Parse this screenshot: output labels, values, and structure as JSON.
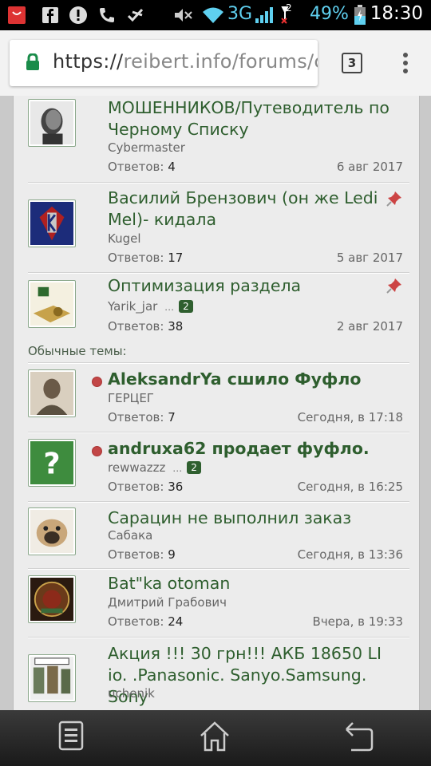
{
  "status_bar": {
    "network": "3G",
    "signal_extra": "2",
    "battery": "49%",
    "time": "18:30"
  },
  "browser": {
    "url_scheme": "https://",
    "url_rest": "reibert.info/forums/ch",
    "tab_count": "3"
  },
  "labels": {
    "replies": "Ответов:",
    "regular_topics": "Обычные темы:",
    "ellipsis": "…"
  },
  "threads": [
    {
      "title": "МОШЕННИКОВ/Путеводитель по Черному Списку",
      "author": "Cybermaster",
      "replies": "4",
      "date": "6 авг 2017"
    },
    {
      "title": "Василий Брензович (он же Ledi Mel)- кидала",
      "author": "Kugel",
      "replies": "17",
      "date": "5 авг 2017"
    },
    {
      "title": "Оптимизация раздела",
      "author": "Yarik_jar",
      "page": "2",
      "replies": "38",
      "date": "2 авг 2017"
    },
    {
      "title": "AleksandrYa сшило Фуфло",
      "author": "ГЕРЦЕГ",
      "replies": "7",
      "date": "Сегодня, в 17:18"
    },
    {
      "title": "andruxa62 продает фуфло.",
      "author": "rewwazzz",
      "page": "2",
      "replies": "36",
      "date": "Сегодня, в 16:25"
    },
    {
      "title": "Сарацин не выполнил заказ",
      "author": "Сабака",
      "replies": "9",
      "date": "Сегодня, в 13:36"
    },
    {
      "title": "Bat\"ka otoman",
      "author": "Дмитрий Грабович",
      "replies": "24",
      "date": "Вчера, в 19:33"
    },
    {
      "title": "Акция !!! 30 грн!!! АКБ 18650 LI io. .Panasonic. Sanyo.Samsung. Sony",
      "author": "uchenik",
      "replies": "",
      "date": ""
    }
  ]
}
